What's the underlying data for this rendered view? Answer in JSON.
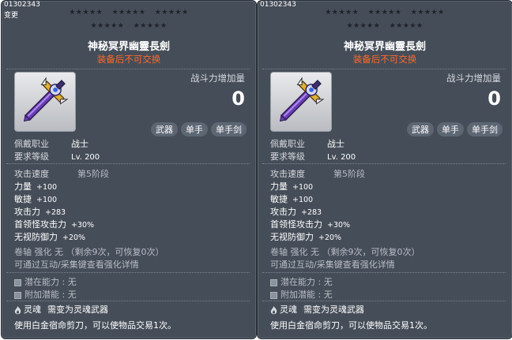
{
  "cards": [
    {
      "id_text": "01302343",
      "change_text": "变更",
      "stars": "★★★★★",
      "title": "神秘冥界幽靈長劍",
      "untradeable": "装备后不可交换",
      "power_label": "战斗力增加量",
      "power_value": "0",
      "tags": [
        "武器",
        "单手",
        "单手剑"
      ],
      "job_label": "佩戴职业",
      "job_value": "战士",
      "level_label": "要求等级",
      "level_value": "Lv. 200",
      "speed_label": "攻击速度",
      "speed_value": "第5阶段",
      "stats": [
        {
          "label": "力量",
          "value": "+100"
        },
        {
          "label": "敏捷",
          "value": "+100"
        },
        {
          "label": "攻击力",
          "value": "+283"
        },
        {
          "label": "首领怪攻击力",
          "value": "+30%"
        },
        {
          "label": "无视防御力",
          "value": "+20%"
        }
      ],
      "scroll_text": "卷轴 强化 无 （剩余9次，可恢复0次）",
      "enhance_hint": "可通过互动/采集键查看强化详情",
      "potential_label": "潜在能力",
      "potential_value": "无",
      "bonus_label": "附加潜能",
      "bonus_value": "无",
      "soul_label": "灵魂",
      "soul_value": "需变为灵魂武器",
      "footer": "使用白金宿命剪刀，可以使物品交易1次。"
    },
    {
      "id_text": "01302343",
      "change_text": "",
      "stars": "★★★★★",
      "title": "神秘冥界幽靈長劍",
      "untradeable": "装备后不可交换",
      "power_label": "战斗力增加量",
      "power_value": "0",
      "tags": [
        "武器",
        "单手",
        "单手剑"
      ],
      "job_label": "佩戴职业",
      "job_value": "战士",
      "level_label": "要求等级",
      "level_value": "Lv. 200",
      "speed_label": "攻击速度",
      "speed_value": "第5阶段",
      "stats": [
        {
          "label": "力量",
          "value": "+100"
        },
        {
          "label": "敏捷",
          "value": "+100"
        },
        {
          "label": "攻击力",
          "value": "+283"
        },
        {
          "label": "首领怪攻击力",
          "value": "+30%"
        },
        {
          "label": "无视防御力",
          "value": "+20%"
        }
      ],
      "scroll_text": "卷轴 强化 无 （剩余9次，可恢复0次）",
      "enhance_hint": "可通过互动/采集键查看强化详情",
      "potential_label": "潜在能力",
      "potential_value": "无",
      "bonus_label": "附加潜能",
      "bonus_value": "无",
      "soul_label": "灵魂",
      "soul_value": "需变为灵魂武器",
      "footer": "使用白金宿命剪刀，可以使物品交易1次。"
    }
  ],
  "colors": {
    "panel_bg": "#454d58",
    "untradeable": "#ff6a2b",
    "tag_bg": "#5d6673"
  },
  "icons": [
    "sword-item-icon",
    "star-icon",
    "flame-icon",
    "bullet-icon"
  ]
}
